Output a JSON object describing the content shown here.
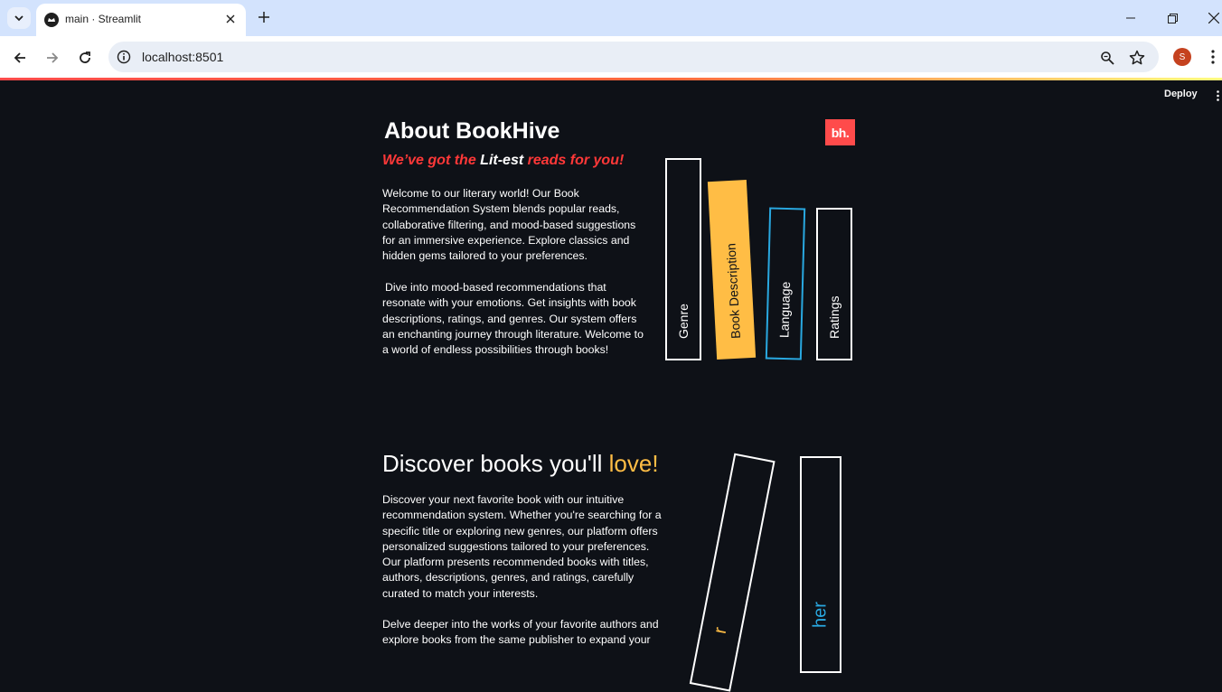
{
  "browser": {
    "tab_title": "main · Streamlit",
    "url": "localhost:8501",
    "profile_initial": "S"
  },
  "streamlit": {
    "deploy_label": "Deploy"
  },
  "about": {
    "heading": "About BookHive",
    "tagline_pre": "We’ve got the ",
    "tagline_highlight": "Lit-est",
    "tagline_post": " reads for you!",
    "paragraph1": "Welcome to our literary world! Our Book Recommendation System blends popular reads, collaborative filtering, and mood-based suggestions for an immersive experience. Explore classics and hidden gems tailored to your preferences.",
    "paragraph2": "Dive into mood-based recommendations that resonate with your emotions. Get insights with book descriptions, ratings, and genres. Our system offers an enchanting journey through literature. Welcome to a world of endless possibilities through books!",
    "logo_text": "bh.",
    "books": [
      {
        "label": "Genre"
      },
      {
        "label": "Book Description"
      },
      {
        "label": "Language"
      },
      {
        "label": "Ratings"
      }
    ]
  },
  "discover": {
    "heading_pre": "Discover books you'll ",
    "heading_highlight": "love!",
    "paragraph1": "Discover your next favorite book with our intuitive recommendation system. Whether you're searching for a specific title or exploring new genres, our platform offers personalized suggestions tailored to your preferences. Our platform presents recommended books with titles, authors, descriptions, genres, and ratings, carefully curated to match your interests.",
    "paragraph2": "Delve deeper into the works of your favorite authors and explore books from the same publisher to expand your",
    "books": [
      {
        "label": "r"
      },
      {
        "label": "her"
      }
    ]
  },
  "colors": {
    "background": "#0e1117",
    "accent_red": "#ff4b4b",
    "accent_orange": "#ffbd45",
    "accent_blue": "#29a8e0",
    "text": "#ffffff"
  }
}
